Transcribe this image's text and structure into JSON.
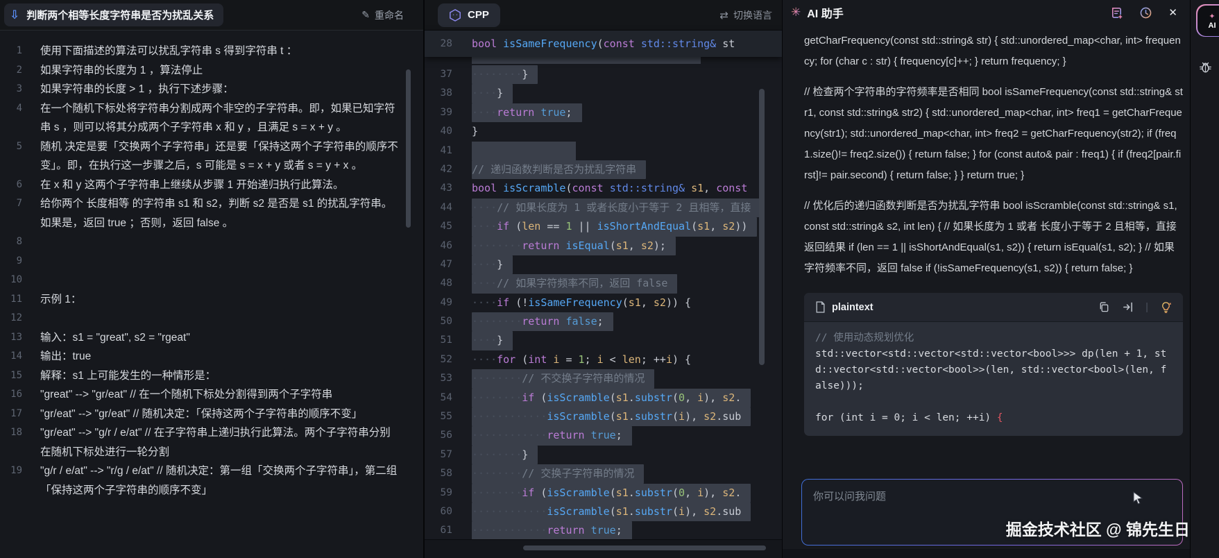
{
  "left_panel": {
    "title": "判断两个相等长度字符串是否为扰乱关系",
    "rename_label": "重命名",
    "lines": [
      {
        "no": "1",
        "text": "使用下面描述的算法可以扰乱字符串 s 得到字符串 t ："
      },
      {
        "no": "2",
        "text": "如果字符串的长度为 1 ，算法停止"
      },
      {
        "no": "3",
        "text": "如果字符串的长度 > 1 ，执行下述步骤："
      },
      {
        "no": "4",
        "text": "在一个随机下标处将字符串分割成两个非空的子字符串。即，如果已知字符串 s ，则可以将其分成两个子字符串 x 和 y ，且满足 s = x + y 。"
      },
      {
        "no": "5",
        "text": "随机 决定是要「交换两个子字符串」还是要「保持这两个子字符串的顺序不变」。即，在执行这一步骤之后，s 可能是 s = x + y 或者 s = y + x 。"
      },
      {
        "no": "6",
        "text": "在 x 和 y 这两个子字符串上继续从步骤 1 开始递归执行此算法。"
      },
      {
        "no": "7",
        "text": "给你两个 长度相等 的字符串 s1 和 s2，判断 s2 是否是 s1 的扰乱字符串。如果是，返回 true ；否则，返回 false 。"
      },
      {
        "no": "8",
        "text": ""
      },
      {
        "no": "9",
        "text": ""
      },
      {
        "no": "10",
        "text": ""
      },
      {
        "no": "11",
        "text": "示例 1："
      },
      {
        "no": "12",
        "text": ""
      },
      {
        "no": "13",
        "text": "输入：s1 = \"great\", s2 = \"rgeat\""
      },
      {
        "no": "14",
        "text": "输出：true"
      },
      {
        "no": "15",
        "text": "解释：s1 上可能发生的一种情形是："
      },
      {
        "no": "16",
        "text": "\"great\" --> \"gr/eat\" // 在一个随机下标处分割得到两个子字符串"
      },
      {
        "no": "17",
        "text": "\"gr/eat\" --> \"gr/eat\" // 随机决定：「保持这两个子字符串的顺序不变」"
      },
      {
        "no": "18",
        "text": "\"gr/eat\" --> \"g/r / e/at\" // 在子字符串上递归执行此算法。两个子字符串分别在随机下标处进行一轮分割"
      },
      {
        "no": "19",
        "text": "\"g/r / e/at\" --> \"r/g / e/at\" // 随机决定：第一组「交换两个子字符串」，第二组「保持这两个子字符串的顺序不变」"
      }
    ]
  },
  "editor_panel": {
    "tab_label": "CPP",
    "switch_language_label": "切换语言",
    "sticky_line": {
      "no": "28",
      "hl": false,
      "tokens": [
        [
          "kw",
          "bool "
        ],
        [
          "fn",
          "isSameFrequency"
        ],
        [
          "pln",
          "("
        ],
        [
          "kw",
          "const "
        ],
        [
          "typ",
          "std::string&"
        ],
        [
          "pln",
          " st"
        ]
      ]
    },
    "code_lines": [
      {
        "no": "37",
        "hl": true,
        "tokens": [
          [
            "pln",
            "        }"
          ]
        ]
      },
      {
        "no": "38",
        "hl": true,
        "tokens": [
          [
            "pln",
            "    }"
          ]
        ]
      },
      {
        "no": "39",
        "hl": true,
        "tokens": [
          [
            "pln",
            "    "
          ],
          [
            "kw",
            "return "
          ],
          [
            "lit",
            "true"
          ],
          [
            "pln",
            ";"
          ]
        ]
      },
      {
        "no": "40",
        "hl": false,
        "tokens": [
          [
            "pln",
            "}"
          ]
        ]
      },
      {
        "no": "41",
        "hl": true,
        "tokens": []
      },
      {
        "no": "42",
        "hl": true,
        "tokens": [
          [
            "cmt",
            "// 递归函数判断是否为扰乱字符串"
          ]
        ]
      },
      {
        "no": "43",
        "hl": false,
        "tokens": [
          [
            "kw",
            "bool "
          ],
          [
            "fn",
            "isScramble"
          ],
          [
            "pln",
            "("
          ],
          [
            "kw",
            "const "
          ],
          [
            "typ",
            "std::string&"
          ],
          [
            "var",
            " s1"
          ],
          [
            "pln",
            ", "
          ],
          [
            "kw",
            "const"
          ]
        ]
      },
      {
        "no": "44",
        "hl": true,
        "tokens": [
          [
            "pln",
            "    "
          ],
          [
            "cmt",
            "// 如果长度为 1 或者长度小于等于 2 且相等，直接"
          ]
        ]
      },
      {
        "no": "45",
        "hl": true,
        "tokens": [
          [
            "pln",
            "    "
          ],
          [
            "kw",
            "if "
          ],
          [
            "pln",
            "("
          ],
          [
            "var",
            "len"
          ],
          [
            "pln",
            " == "
          ],
          [
            "num",
            "1"
          ],
          [
            "pln",
            " || "
          ],
          [
            "fn",
            "isShortAndEqual"
          ],
          [
            "pln",
            "("
          ],
          [
            "var",
            "s1"
          ],
          [
            "pln",
            ", "
          ],
          [
            "var",
            "s2"
          ],
          [
            "pln",
            "))"
          ]
        ]
      },
      {
        "no": "46",
        "hl": true,
        "tokens": [
          [
            "pln",
            "        "
          ],
          [
            "kw",
            "return "
          ],
          [
            "fn",
            "isEqual"
          ],
          [
            "pln",
            "("
          ],
          [
            "var",
            "s1"
          ],
          [
            "pln",
            ", "
          ],
          [
            "var",
            "s2"
          ],
          [
            "pln",
            ");"
          ]
        ]
      },
      {
        "no": "47",
        "hl": true,
        "tokens": [
          [
            "pln",
            "    }"
          ]
        ]
      },
      {
        "no": "48",
        "hl": true,
        "tokens": [
          [
            "pln",
            "    "
          ],
          [
            "cmt",
            "// 如果字符频率不同，返回 false"
          ]
        ]
      },
      {
        "no": "49",
        "hl": false,
        "tokens": [
          [
            "pln",
            "    "
          ],
          [
            "kw",
            "if "
          ],
          [
            "pln",
            "(!"
          ],
          [
            "fn",
            "isSameFrequency"
          ],
          [
            "pln",
            "("
          ],
          [
            "var",
            "s1"
          ],
          [
            "pln",
            ", "
          ],
          [
            "var",
            "s2"
          ],
          [
            "pln",
            ")) {"
          ]
        ]
      },
      {
        "no": "50",
        "hl": true,
        "tokens": [
          [
            "pln",
            "        "
          ],
          [
            "kw",
            "return "
          ],
          [
            "lit",
            "false"
          ],
          [
            "pln",
            ";"
          ]
        ]
      },
      {
        "no": "51",
        "hl": true,
        "tokens": [
          [
            "pln",
            "    }"
          ]
        ]
      },
      {
        "no": "52",
        "hl": false,
        "tokens": [
          [
            "pln",
            "    "
          ],
          [
            "kw",
            "for "
          ],
          [
            "pln",
            "("
          ],
          [
            "kw",
            "int "
          ],
          [
            "var",
            "i"
          ],
          [
            "pln",
            " = "
          ],
          [
            "num",
            "1"
          ],
          [
            "pln",
            "; "
          ],
          [
            "var",
            "i"
          ],
          [
            "pln",
            " < "
          ],
          [
            "var",
            "len"
          ],
          [
            "pln",
            "; ++"
          ],
          [
            "var",
            "i"
          ],
          [
            "pln",
            ") {"
          ]
        ]
      },
      {
        "no": "53",
        "hl": true,
        "tokens": [
          [
            "pln",
            "        "
          ],
          [
            "cmt",
            "// 不交换子字符串的情况"
          ]
        ]
      },
      {
        "no": "54",
        "hl": true,
        "tokens": [
          [
            "pln",
            "        "
          ],
          [
            "kw",
            "if "
          ],
          [
            "pln",
            "("
          ],
          [
            "fn",
            "isScramble"
          ],
          [
            "pln",
            "("
          ],
          [
            "var",
            "s1"
          ],
          [
            "pln",
            "."
          ],
          [
            "fn",
            "substr"
          ],
          [
            "pln",
            "("
          ],
          [
            "num",
            "0"
          ],
          [
            "pln",
            ", "
          ],
          [
            "var",
            "i"
          ],
          [
            "pln",
            "), "
          ],
          [
            "var",
            "s2"
          ],
          [
            "pln",
            "."
          ]
        ]
      },
      {
        "no": "55",
        "hl": true,
        "tokens": [
          [
            "pln",
            "            "
          ],
          [
            "fn",
            "isScramble"
          ],
          [
            "pln",
            "("
          ],
          [
            "var",
            "s1"
          ],
          [
            "pln",
            "."
          ],
          [
            "fn",
            "substr"
          ],
          [
            "pln",
            "("
          ],
          [
            "var",
            "i"
          ],
          [
            "pln",
            "), "
          ],
          [
            "var",
            "s2"
          ],
          [
            "pln",
            ".sub"
          ]
        ]
      },
      {
        "no": "56",
        "hl": true,
        "tokens": [
          [
            "pln",
            "            "
          ],
          [
            "kw",
            "return "
          ],
          [
            "lit",
            "true"
          ],
          [
            "pln",
            ";"
          ]
        ]
      },
      {
        "no": "57",
        "hl": true,
        "tokens": [
          [
            "pln",
            "        }"
          ]
        ]
      },
      {
        "no": "58",
        "hl": true,
        "tokens": [
          [
            "pln",
            "        "
          ],
          [
            "cmt",
            "// 交换子字符串的情况"
          ]
        ]
      },
      {
        "no": "59",
        "hl": true,
        "tokens": [
          [
            "pln",
            "        "
          ],
          [
            "kw",
            "if "
          ],
          [
            "pln",
            "("
          ],
          [
            "fn",
            "isScramble"
          ],
          [
            "pln",
            "("
          ],
          [
            "var",
            "s1"
          ],
          [
            "pln",
            "."
          ],
          [
            "fn",
            "substr"
          ],
          [
            "pln",
            "("
          ],
          [
            "num",
            "0"
          ],
          [
            "pln",
            ", "
          ],
          [
            "var",
            "i"
          ],
          [
            "pln",
            "), "
          ],
          [
            "var",
            "s2"
          ],
          [
            "pln",
            "."
          ]
        ]
      },
      {
        "no": "60",
        "hl": true,
        "tokens": [
          [
            "pln",
            "            "
          ],
          [
            "fn",
            "isScramble"
          ],
          [
            "pln",
            "("
          ],
          [
            "var",
            "s1"
          ],
          [
            "pln",
            "."
          ],
          [
            "fn",
            "substr"
          ],
          [
            "pln",
            "("
          ],
          [
            "var",
            "i"
          ],
          [
            "pln",
            "), "
          ],
          [
            "var",
            "s2"
          ],
          [
            "pln",
            ".sub"
          ]
        ]
      },
      {
        "no": "61",
        "hl": true,
        "tokens": [
          [
            "pln",
            "            "
          ],
          [
            "kw",
            "return "
          ],
          [
            "lit",
            "true"
          ],
          [
            "pln",
            ";"
          ]
        ]
      }
    ]
  },
  "ai_panel": {
    "title": "AI 助手",
    "messages": [
      "getCharFrequency(const std::string& str) { std::unordered_map<char, int> frequency; for (char c : str) { frequency[c]++; } return frequency; }",
      "// 检查两个字符串的字符频率是否相同 bool isSameFrequency(const std::string& str1, const std::string& str2) { std::unordered_map<char, int> freq1 = getCharFrequency(str1); std::unordered_map<char, int> freq2 = getCharFrequency(str2); if (freq1.size()!= freq2.size()) { return false; } for (const auto& pair : freq1) { if (freq2[pair.first]!= pair.second) { return false; } } return true; }",
      "// 优化后的递归函数判断是否为扰乱字符串 bool isScramble(const std::string& s1, const std::string& s2, int len) { // 如果长度为 1 或者 长度小于等于 2 且相等，直接返回结果 if (len == 1 || isShortAndEqual(s1, s2)) { return isEqual(s1, s2); } // 如果字符频率不同，返回 false if (!isSameFrequency(s1, s2)) { return false; }"
    ],
    "code_block": {
      "lang_label": "plaintext",
      "lines": [
        [
          [
            "cmt",
            "// 使用动态规划优化"
          ]
        ],
        [
          [
            "pln",
            "std::vector<std::vector<std::vector<bool>>> dp(len + 1, std::vector<std::vector<bool>>(len, std::vector<bool>(len, false)));"
          ]
        ],
        [
          [
            "pln",
            " "
          ]
        ],
        [
          [
            "pln",
            "for (int i = 0; i < len; ++i) "
          ],
          [
            "err",
            "{"
          ]
        ]
      ]
    },
    "input_placeholder": "你可以问我问题",
    "watermark": "掘金技术社区 @ 锦先生日"
  },
  "right_rail": {
    "ai_badge_label": "AI"
  },
  "icons": {
    "download": "⇩",
    "pencil": "✎",
    "swap": "⇄",
    "sparkle": "✳",
    "pill_sparkle": "✦",
    "close": "✕"
  },
  "colors": {
    "syntax_keyword": "#bb7cd6",
    "syntax_function": "#56a8f5",
    "syntax_type": "#6189e8",
    "syntax_variable": "#dcb67a",
    "syntax_number": "#98c379",
    "syntax_literal": "#569cd6",
    "syntax_comment": "#747d8a",
    "syntax_error": "#e05561",
    "highlight_bg": "#3a3f4a",
    "accent_blue": "#5a8df5",
    "gradient_input": [
      "#3f6fd8",
      "#7668e2",
      "#c06cc0"
    ],
    "gradient_ai_pill": [
      "#e98fb4",
      "#8f7cf0"
    ]
  }
}
